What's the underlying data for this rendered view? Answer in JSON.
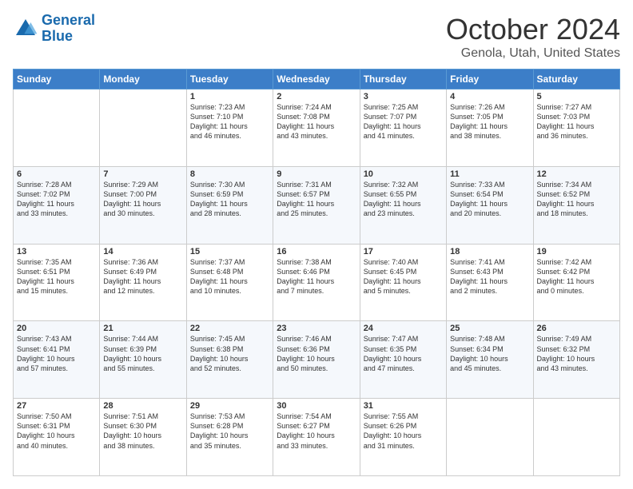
{
  "logo": {
    "line1": "General",
    "line2": "Blue"
  },
  "header": {
    "month": "October 2024",
    "location": "Genola, Utah, United States"
  },
  "weekdays": [
    "Sunday",
    "Monday",
    "Tuesday",
    "Wednesday",
    "Thursday",
    "Friday",
    "Saturday"
  ],
  "weeks": [
    [
      {
        "day": "",
        "info": ""
      },
      {
        "day": "",
        "info": ""
      },
      {
        "day": "1",
        "info": "Sunrise: 7:23 AM\nSunset: 7:10 PM\nDaylight: 11 hours\nand 46 minutes."
      },
      {
        "day": "2",
        "info": "Sunrise: 7:24 AM\nSunset: 7:08 PM\nDaylight: 11 hours\nand 43 minutes."
      },
      {
        "day": "3",
        "info": "Sunrise: 7:25 AM\nSunset: 7:07 PM\nDaylight: 11 hours\nand 41 minutes."
      },
      {
        "day": "4",
        "info": "Sunrise: 7:26 AM\nSunset: 7:05 PM\nDaylight: 11 hours\nand 38 minutes."
      },
      {
        "day": "5",
        "info": "Sunrise: 7:27 AM\nSunset: 7:03 PM\nDaylight: 11 hours\nand 36 minutes."
      }
    ],
    [
      {
        "day": "6",
        "info": "Sunrise: 7:28 AM\nSunset: 7:02 PM\nDaylight: 11 hours\nand 33 minutes."
      },
      {
        "day": "7",
        "info": "Sunrise: 7:29 AM\nSunset: 7:00 PM\nDaylight: 11 hours\nand 30 minutes."
      },
      {
        "day": "8",
        "info": "Sunrise: 7:30 AM\nSunset: 6:59 PM\nDaylight: 11 hours\nand 28 minutes."
      },
      {
        "day": "9",
        "info": "Sunrise: 7:31 AM\nSunset: 6:57 PM\nDaylight: 11 hours\nand 25 minutes."
      },
      {
        "day": "10",
        "info": "Sunrise: 7:32 AM\nSunset: 6:55 PM\nDaylight: 11 hours\nand 23 minutes."
      },
      {
        "day": "11",
        "info": "Sunrise: 7:33 AM\nSunset: 6:54 PM\nDaylight: 11 hours\nand 20 minutes."
      },
      {
        "day": "12",
        "info": "Sunrise: 7:34 AM\nSunset: 6:52 PM\nDaylight: 11 hours\nand 18 minutes."
      }
    ],
    [
      {
        "day": "13",
        "info": "Sunrise: 7:35 AM\nSunset: 6:51 PM\nDaylight: 11 hours\nand 15 minutes."
      },
      {
        "day": "14",
        "info": "Sunrise: 7:36 AM\nSunset: 6:49 PM\nDaylight: 11 hours\nand 12 minutes."
      },
      {
        "day": "15",
        "info": "Sunrise: 7:37 AM\nSunset: 6:48 PM\nDaylight: 11 hours\nand 10 minutes."
      },
      {
        "day": "16",
        "info": "Sunrise: 7:38 AM\nSunset: 6:46 PM\nDaylight: 11 hours\nand 7 minutes."
      },
      {
        "day": "17",
        "info": "Sunrise: 7:40 AM\nSunset: 6:45 PM\nDaylight: 11 hours\nand 5 minutes."
      },
      {
        "day": "18",
        "info": "Sunrise: 7:41 AM\nSunset: 6:43 PM\nDaylight: 11 hours\nand 2 minutes."
      },
      {
        "day": "19",
        "info": "Sunrise: 7:42 AM\nSunset: 6:42 PM\nDaylight: 11 hours\nand 0 minutes."
      }
    ],
    [
      {
        "day": "20",
        "info": "Sunrise: 7:43 AM\nSunset: 6:41 PM\nDaylight: 10 hours\nand 57 minutes."
      },
      {
        "day": "21",
        "info": "Sunrise: 7:44 AM\nSunset: 6:39 PM\nDaylight: 10 hours\nand 55 minutes."
      },
      {
        "day": "22",
        "info": "Sunrise: 7:45 AM\nSunset: 6:38 PM\nDaylight: 10 hours\nand 52 minutes."
      },
      {
        "day": "23",
        "info": "Sunrise: 7:46 AM\nSunset: 6:36 PM\nDaylight: 10 hours\nand 50 minutes."
      },
      {
        "day": "24",
        "info": "Sunrise: 7:47 AM\nSunset: 6:35 PM\nDaylight: 10 hours\nand 47 minutes."
      },
      {
        "day": "25",
        "info": "Sunrise: 7:48 AM\nSunset: 6:34 PM\nDaylight: 10 hours\nand 45 minutes."
      },
      {
        "day": "26",
        "info": "Sunrise: 7:49 AM\nSunset: 6:32 PM\nDaylight: 10 hours\nand 43 minutes."
      }
    ],
    [
      {
        "day": "27",
        "info": "Sunrise: 7:50 AM\nSunset: 6:31 PM\nDaylight: 10 hours\nand 40 minutes."
      },
      {
        "day": "28",
        "info": "Sunrise: 7:51 AM\nSunset: 6:30 PM\nDaylight: 10 hours\nand 38 minutes."
      },
      {
        "day": "29",
        "info": "Sunrise: 7:53 AM\nSunset: 6:28 PM\nDaylight: 10 hours\nand 35 minutes."
      },
      {
        "day": "30",
        "info": "Sunrise: 7:54 AM\nSunset: 6:27 PM\nDaylight: 10 hours\nand 33 minutes."
      },
      {
        "day": "31",
        "info": "Sunrise: 7:55 AM\nSunset: 6:26 PM\nDaylight: 10 hours\nand 31 minutes."
      },
      {
        "day": "",
        "info": ""
      },
      {
        "day": "",
        "info": ""
      }
    ]
  ]
}
